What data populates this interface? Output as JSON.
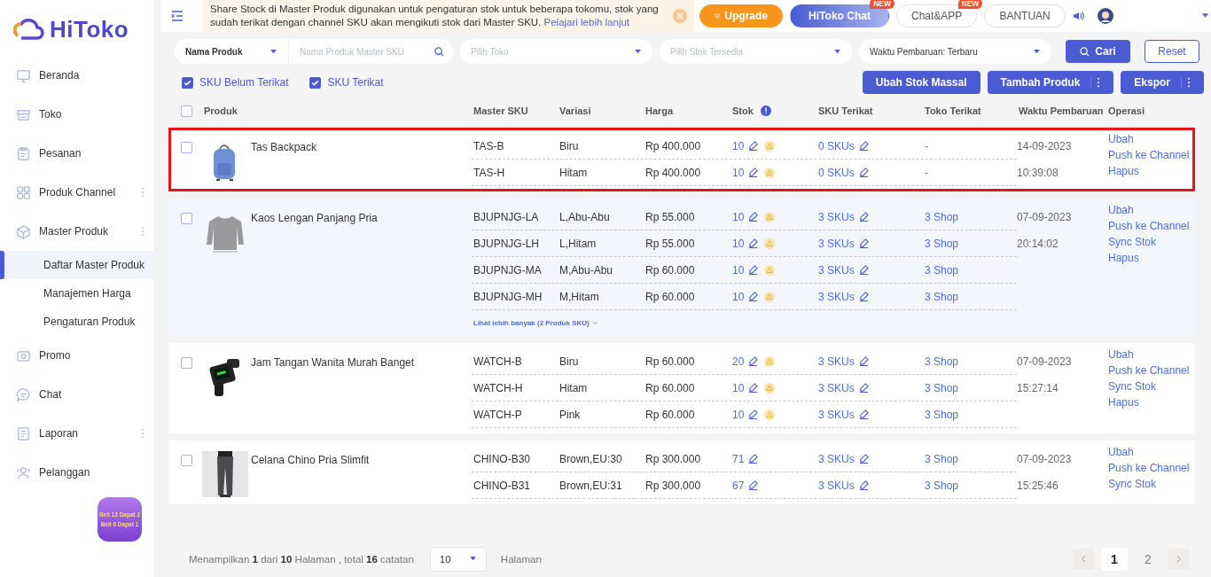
{
  "sidebar": {
    "logo": "HiToko",
    "items": [
      {
        "label": "Beranda",
        "has_more": false
      },
      {
        "label": "Toko",
        "has_more": false
      },
      {
        "label": "Pesanan",
        "has_more": false
      },
      {
        "label": "Produk Channel",
        "has_more": true
      },
      {
        "label": "Master Produk",
        "has_more": true,
        "children": [
          {
            "label": "Daftar Master Produk",
            "selected": true
          },
          {
            "label": "Manajemen Harga",
            "selected": false
          },
          {
            "label": "Pengaturan Produk",
            "selected": false
          }
        ]
      },
      {
        "label": "Promo",
        "has_more": false
      },
      {
        "label": "Chat",
        "has_more": false
      },
      {
        "label": "Laporan",
        "has_more": true
      },
      {
        "label": "Pelanggan",
        "has_more": false
      }
    ],
    "promo_badge": [
      "Beli 12 Dapat 2",
      "Beli 6 Dapat 1"
    ]
  },
  "topbar": {
    "notice": "Share Stock di Master Produk digunakan untuk pengaturan stok untuk beberapa tokomu, stok yang sudah terikat dengan channel SKU akan mengikuti stok dari Master SKU.",
    "notice_link": "Pelajari lebih lanjut",
    "buttons": [
      {
        "label": "Upgrade",
        "kind": "upgrade"
      },
      {
        "label": "HiToko Chat",
        "kind": "chat",
        "badge": "NEW"
      },
      {
        "label": "Chat&APP",
        "kind": "outline",
        "badge": "NEW"
      },
      {
        "label": "BANTUAN",
        "kind": "outline"
      }
    ]
  },
  "filters": {
    "field_select": "Nama Produk",
    "search_placeholder": "Nama Produk Master SKU",
    "shop_placeholder": "Pilih Toko",
    "stock_placeholder": "Pilih Stok Tersedia",
    "sort": "Waktu Pembaruan: Terbaru",
    "search_button": "Cari",
    "reset_button": "Reset"
  },
  "checkboxes": [
    {
      "label": "SKU Belum Terikat",
      "checked": true
    },
    {
      "label": "SKU Terikat",
      "checked": true
    }
  ],
  "actions": [
    {
      "label": "Ubah Stok Massal",
      "has_more": false
    },
    {
      "label": "Tambah Produk",
      "has_more": true
    },
    {
      "label": "Ekspor",
      "has_more": true
    }
  ],
  "table": {
    "all_checked": false,
    "columns": [
      "Produk",
      "Master SKU",
      "Variasi",
      "Harga",
      "Stok",
      "SKU Terikat",
      "Toko Terikat",
      "Waktu Pembaruan",
      "Operasi"
    ],
    "products": [
      {
        "name": "Tas Backpack",
        "highlighted": true,
        "hovered": false,
        "checked": false,
        "date": "14-09-2023",
        "time": "10:39:08",
        "operations": [
          "Ubah",
          "Push ke Channel",
          "Hapus"
        ],
        "skus": [
          {
            "sku": "TAS-B",
            "variation": "Biru",
            "price": "Rp 400.000",
            "stock": "10",
            "warning": true,
            "bound": "0 SKUs",
            "shops": "-"
          },
          {
            "sku": "TAS-H",
            "variation": "Hitam",
            "price": "Rp 400.000",
            "stock": "10",
            "warning": true,
            "bound": "0 SKUs",
            "shops": "-"
          }
        ]
      },
      {
        "name": "Kaos Lengan Panjang Pria",
        "highlighted": false,
        "hovered": true,
        "checked": false,
        "date": "07-09-2023",
        "time": "20:14:02",
        "operations": [
          "Ubah",
          "Push ke Channel",
          "Sync Stok",
          "Hapus"
        ],
        "skus": [
          {
            "sku": "BJUPNJG-LA",
            "variation": "L,Abu-Abu",
            "price": "Rp 55.000",
            "stock": "10",
            "warning": true,
            "bound": "3 SKUs",
            "shops": "3 Shop"
          },
          {
            "sku": "BJUPNJG-LH",
            "variation": "L,Hitam",
            "price": "Rp 55.000",
            "stock": "10",
            "warning": true,
            "bound": "3 SKUs",
            "shops": "3 Shop"
          },
          {
            "sku": "BJUPNJG-MA",
            "variation": "M,Abu-Abu",
            "price": "Rp 60.000",
            "stock": "10",
            "warning": true,
            "bound": "3 SKUs",
            "shops": "3 Shop"
          },
          {
            "sku": "BJUPNJG-MH",
            "variation": "M,Hitam",
            "price": "Rp 60.000",
            "stock": "10",
            "warning": true,
            "bound": "3 SKUs",
            "shops": "3 Shop"
          }
        ],
        "more_link": "Lihat lebih banyak (2 Produk SKU)"
      },
      {
        "name": "Jam Tangan Wanita Murah Banget",
        "highlighted": false,
        "hovered": false,
        "checked": false,
        "date": "07-09-2023",
        "time": "15:27:14",
        "operations": [
          "Ubah",
          "Push ke Channel",
          "Sync Stok",
          "Hapus"
        ],
        "skus": [
          {
            "sku": "WATCH-B",
            "variation": "Biru",
            "price": "Rp 60.000",
            "stock": "20",
            "warning": true,
            "bound": "3 SKUs",
            "shops": "3 Shop"
          },
          {
            "sku": "WATCH-H",
            "variation": "Hitam",
            "price": "Rp 60.000",
            "stock": "10",
            "warning": true,
            "bound": "3 SKUs",
            "shops": "3 Shop"
          },
          {
            "sku": "WATCH-P",
            "variation": "Pink",
            "price": "Rp 60.000",
            "stock": "10",
            "warning": true,
            "bound": "3 SKUs",
            "shops": "3 Shop"
          }
        ]
      },
      {
        "name": "Celana Chino Pria Slimfit",
        "highlighted": false,
        "hovered": false,
        "checked": false,
        "date": "07-09-2023",
        "time": "15:25:46",
        "operations": [
          "Ubah",
          "Push ke Channel",
          "Sync Stok"
        ],
        "skus": [
          {
            "sku": "CHINO-B30",
            "variation": "Brown,EU:30",
            "price": "Rp 300.000",
            "stock": "71",
            "warning": false,
            "bound": "3 SKUs",
            "shops": "3 Shop"
          },
          {
            "sku": "CHINO-B31",
            "variation": "Brown,EU:31",
            "price": "Rp 300.000",
            "stock": "67",
            "warning": false,
            "bound": "3 SKUs",
            "shops": "3 Shop"
          }
        ]
      }
    ]
  },
  "footer": {
    "summary": "Menampilkan **1** dari **10** Halaman , total **16** catatan",
    "page_size": "10",
    "page_label": "Halaman",
    "pages": [
      {
        "label": "1",
        "selected": true
      },
      {
        "label": "2",
        "selected": false
      }
    ]
  }
}
